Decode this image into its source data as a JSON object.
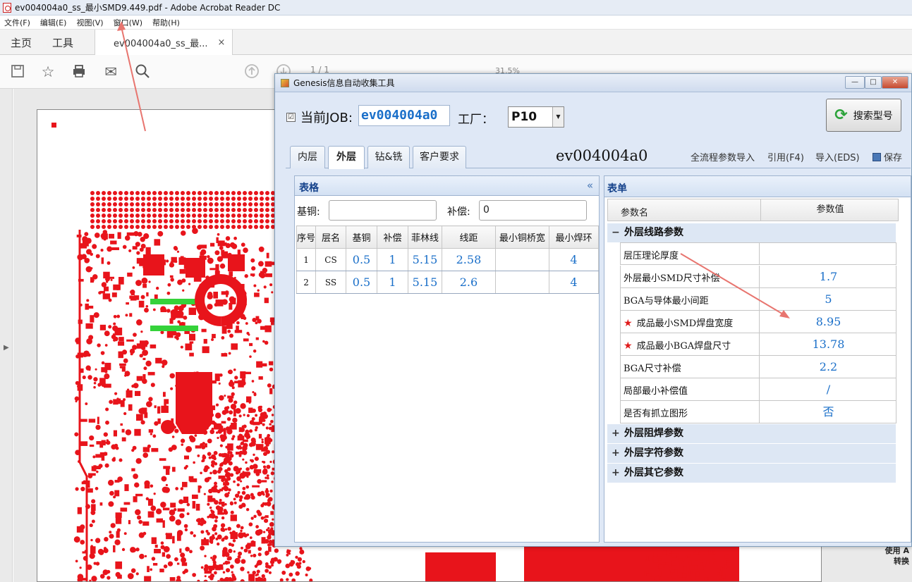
{
  "acrobat": {
    "window_title": "ev004004a0_ss_最小SMD9.449.pdf - Adobe Acrobat Reader DC",
    "menu": [
      "文件(F)",
      "编辑(E)",
      "视图(V)",
      "窗口(W)",
      "帮助(H)"
    ],
    "tabs": {
      "home": "主页",
      "tools": "工具",
      "document": "ev004004a0_ss_最...",
      "close": "×"
    },
    "page_number": "1  /  1",
    "zoom": "31.5%",
    "side_text": [
      "使用 A",
      "转换"
    ]
  },
  "dialog": {
    "title": "Genesis信息自动收集工具",
    "window_buttons": {
      "minimize": "—",
      "maximize": "□",
      "close": "✕"
    },
    "job_checkbox": "☑",
    "job_label": "当前JOB:",
    "job_value": "ev004004a0",
    "factory_label": "工厂：",
    "factory_value": "P10",
    "search_button": "搜索型号",
    "tabs": [
      "内层",
      "外层",
      "钻&铣",
      "客户要求"
    ],
    "active_tab": "外层",
    "job_heading": "ev004004a0",
    "links": {
      "full_flow_import": "全流程参数导入",
      "quote": "引用(F4)",
      "import_eds": "导入(EDS)",
      "save": "保存"
    },
    "left_panel": {
      "title": "表格",
      "collapse_icon": "«",
      "base_copper_label": "基铜:",
      "base_copper_value": "",
      "compensation_label": "补偿:",
      "compensation_value": "0",
      "columns": [
        "序号",
        "层名",
        "基铜",
        "补偿",
        "菲林线",
        "线距",
        "最小铜桥宽",
        "最小焊环"
      ],
      "rows": [
        [
          "1",
          "CS",
          "0.5",
          "1",
          "5.15",
          "2.58",
          "",
          "4"
        ],
        [
          "2",
          "SS",
          "0.5",
          "1",
          "5.15",
          "2.6",
          "",
          "4"
        ]
      ]
    },
    "right_panel": {
      "title": "表单",
      "col_name": "参数名",
      "col_value": "参数值",
      "groups": [
        {
          "label": "外层线路参数",
          "expanded": true
        },
        {
          "label": "外层阻焊参数",
          "expanded": false
        },
        {
          "label": "外层字符参数",
          "expanded": false
        },
        {
          "label": "外层其它参数",
          "expanded": false
        }
      ],
      "expand_icon": "+",
      "collapse_icon": "−",
      "params": [
        {
          "name": "层压理论厚度",
          "value": "",
          "required": false
        },
        {
          "name": "外层最小SMD尺寸补偿",
          "value": "1.7",
          "required": false
        },
        {
          "name": "BGA与导体最小间距",
          "value": "5",
          "required": false
        },
        {
          "name": "成品最小SMD焊盘宽度",
          "value": "8.95",
          "required": true
        },
        {
          "name": "成品最小BGA焊盘尺寸",
          "value": "13.78",
          "required": true
        },
        {
          "name": "BGA尺寸补偿",
          "value": "2.2",
          "required": false
        },
        {
          "name": "局部最小补偿值",
          "value": "/",
          "required": false
        },
        {
          "name": "是否有抓立图形",
          "value": "否",
          "required": false
        }
      ],
      "required_star": "★"
    }
  },
  "colors": {
    "accent": "#1a6fc9",
    "pcb_red": "#e8141b",
    "annotation_arrow": "#e8756f",
    "header_text": "#15428b"
  }
}
